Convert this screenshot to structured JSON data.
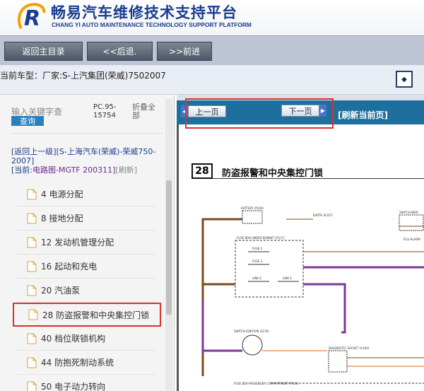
{
  "header": {
    "title_cn": "畅易汽车维修技术支持平台",
    "title_en": "CHANG YI AUTO MAINTENANCE TECHNOLOGY SUPPORT PLATFORM",
    "logo_icon": "logo-r-icon"
  },
  "nav": {
    "home": "返回主目录",
    "back": "<<后退.",
    "forward": ">>前进"
  },
  "car": {
    "text": "当前车型：厂家:S-上汽集团(荣威)7502007",
    "expand_icon": "expand-icon"
  },
  "search": {
    "placeholder": "输入关键字查",
    "button": "查询",
    "pc": "PC.95-15754",
    "fold": "折叠全部"
  },
  "crumb": {
    "up": "[返回上一级]",
    "path": "[S-上海汽车(荣威)-荣威750-2007]",
    "current_label": "[当前:",
    "current": "电路图-MGTF 200311]",
    "refresh": "[刷新]"
  },
  "menu": [
    {
      "label": "4 电源分配"
    },
    {
      "label": "8 接地分配"
    },
    {
      "label": "12 发动机管理分配"
    },
    {
      "label": "16 起动和充电"
    },
    {
      "label": "20 汽油泵"
    },
    {
      "label": "28 防盗报警和中央集控门锁",
      "selected": true
    },
    {
      "label": "40 档位联锁机构"
    },
    {
      "label": "44 防抱死制动系统"
    },
    {
      "label": "50 电子动力转向"
    }
  ],
  "toolbar": {
    "prev": "上一页",
    "next": "下一页",
    "refresh": "[刷新当前页]"
  },
  "diagram": {
    "number": "28",
    "title": "防盗报警和中央集控门锁",
    "labels": {
      "battery": "BATTERY (P100)",
      "fusebox": "FUSE BOX-UNDER BONNET (P137)",
      "fuse2": "FUSE 2",
      "fuse3": "FUSE 3",
      "link6": "LINK 6",
      "link4": "LINK 4",
      "switch_ignition": "SWITCH-IGNITION (S176)",
      "diag_socket": "DIAGNOSTIC SOCKET (V100)",
      "fuse_passenger": "FUSE BOX-PASSENGER COMPARTMENT (P121)",
      "switch_inertia": "SWITCH-INER",
      "ecu_alarm": "ECU-ALARM",
      "earth": "EARTH (E107)"
    }
  },
  "colors": {
    "brand": "#1a3d8f",
    "toolbar": "#1f6f9e",
    "highlight": "#d9322e",
    "wire_brown": "#7b4a1e",
    "wire_purple": "#7a3a9a",
    "wire_orange": "#d46a1a"
  }
}
